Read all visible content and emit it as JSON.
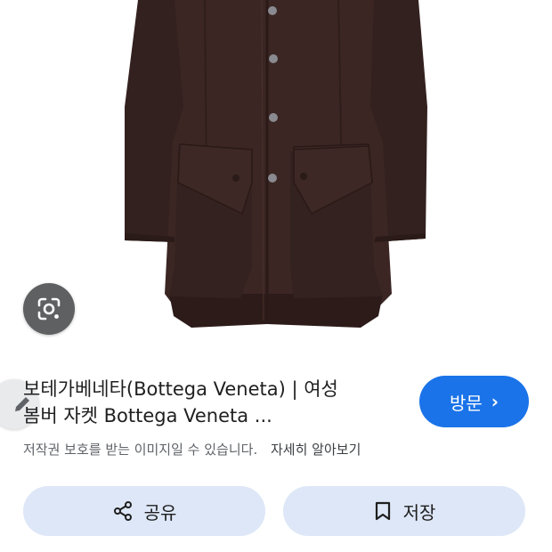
{
  "result": {
    "title_line1": "보테가베네타(Bottega Veneta) | 여성",
    "title_line2": "봄버 자켓 Bottega Veneta ...",
    "notice": "저작권 보호를 받는 이미지일 수 있습니다.",
    "learn_more": "자세히 알아보기"
  },
  "buttons": {
    "visit_label": "방문",
    "visit_chevron": "›",
    "share_label": "공유",
    "save_label": "저장"
  },
  "colors": {
    "accent": "#1a73e8",
    "action_bg": "#dde7f7",
    "jacket": "#3a2522"
  },
  "icons": {
    "lens": "google-lens-icon",
    "edit": "pencil-icon",
    "share": "share-icon",
    "save": "bookmark-icon"
  }
}
